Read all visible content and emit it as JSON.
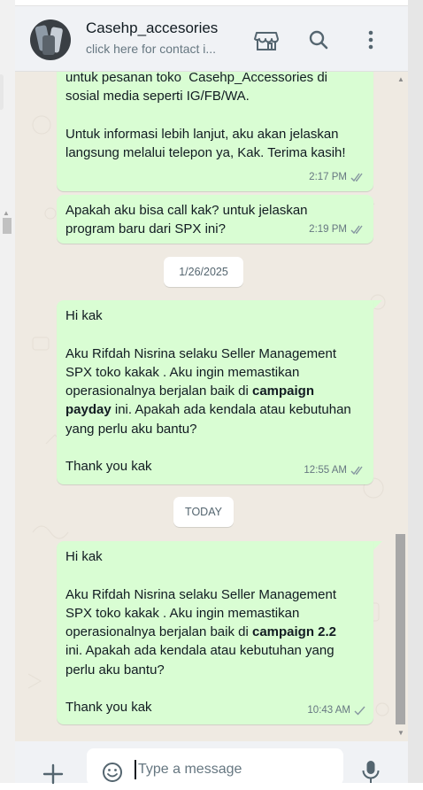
{
  "header": {
    "contact_name": "Casehp_accesories",
    "contact_subtitle": "click here for contact i...",
    "icons": [
      "avatar",
      "store-icon",
      "search-icon",
      "menu-dots-icon"
    ]
  },
  "messages": [
    {
      "text": "untuk pesanan toko  Casehp_Accessories di\nsosial media seperti IG/FB/WA.\n\nUntuk informasi lebih lanjut, aku akan jelaskan\nlangsung melalui telepon ya, Kak. Terima kasih!",
      "time": "2:17 PM",
      "status": "read-ticks"
    },
    {
      "text": "Apakah aku bisa call kak? untuk jelaskan\nprogram baru dari SPX ini?",
      "time": "2:19 PM",
      "status": "read-ticks"
    },
    {
      "line1": "Hi kak",
      "line2": "Aku Rifdah Nisrina selaku Seller Management",
      "line3": "SPX toko kakak . Aku ingin memastikan",
      "line4_pre": "operasionalnya berjalan baik di ",
      "line4_bold": "campaign",
      "line5_bold": "payday",
      "line5_post": " ini. Apakah ada kendala atau kebutuhan",
      "line6": "yang perlu aku bantu?",
      "line7": "Thank you kak",
      "time": "12:55 AM",
      "status": "read-ticks"
    },
    {
      "line1": "Hi kak",
      "line2": "Aku Rifdah Nisrina selaku Seller Management",
      "line3": "SPX toko kakak . Aku ingin memastikan",
      "line4_pre": "operasionalnya berjalan baik di ",
      "line4_bold": "campaign 2.2",
      "line5": "ini. Apakah ada kendala atau kebutuhan yang",
      "line6": "perlu aku bantu?",
      "line7": "Thank you kak",
      "time": "10:43 AM",
      "status": "single-tick"
    }
  ],
  "date_chips": [
    "1/26/2025",
    "TODAY"
  ],
  "composer": {
    "placeholder": "Type a message",
    "icons": [
      "plus-icon",
      "emoji-icon",
      "microphone-icon"
    ]
  },
  "colors": {
    "outgoing_bubble": "#d9fdd3",
    "chat_background": "#efeae2",
    "header_background": "#f0f2f5",
    "tick_grey": "#8696a0"
  }
}
